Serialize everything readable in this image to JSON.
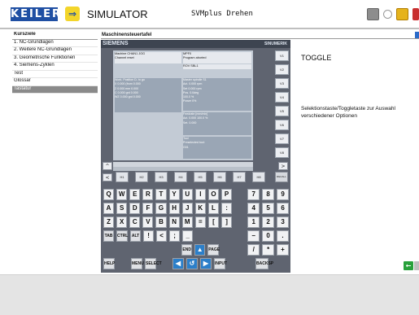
{
  "header": {
    "logo_text": "KEILER",
    "logo_arrow": "⇒",
    "title": "SIMULATOR",
    "subtitle": "SVMplus Drehen"
  },
  "nav": {
    "items": [
      {
        "label": "Kursziele",
        "active": false
      },
      {
        "label": "1. NC-Grundlagen",
        "active": false
      },
      {
        "label": "2. Weitere NC-Grundlagen",
        "active": false
      },
      {
        "label": "3. Geometrische Funktionen",
        "active": false
      },
      {
        "label": "4. Siemens-Zyklen",
        "active": false
      },
      {
        "label": "Test",
        "active": false
      },
      {
        "label": "Glossar",
        "active": false
      },
      {
        "label": "Tastatur",
        "active": true
      }
    ]
  },
  "content": {
    "title": "Maschinensteuertafel"
  },
  "panel": {
    "brand": "SIEMENS",
    "product": "SINUMERIK",
    "screen": {
      "top_left": [
        "Machine CHAN1   JOG",
        "Channel reset"
      ],
      "top_right": [
        "MPF0",
        "Program aborted",
        "ROV SBL1"
      ],
      "wcs_header": "Work.    Position    D- to go",
      "axes": [
        "X        0.000  (from    0.000",
        "Z        0.000  mm       0.000",
        "C        0.000  grd      0.000",
        "WZ       0.000  grd      0.000"
      ],
      "spindle_header": "Master spindle   S1",
      "spindle": [
        "Act.    0.000 rpm",
        "Set     0.000 rpm",
        "Pos.    0.0deg",
        "         100.0 %",
        "Power        0%"
      ],
      "feedrate_header": "Feedrate [mm/min]",
      "feedrate": [
        "Act.    0.000  100.0 %",
        "Set.    0.000"
      ],
      "tool_header": "Tool",
      "tool": [
        "Preselected tool:",
        "G01"
      ]
    },
    "vkeys": [
      "V1",
      "V2",
      "V3",
      "V4",
      "V5",
      "V6",
      "V7",
      "V8"
    ],
    "hkeys": [
      "H1",
      "H2",
      "H3",
      "H4",
      "H5",
      "H6",
      "H7",
      "H8"
    ],
    "recall": "RECALL",
    "rows": [
      {
        "left": "",
        "keys": [
          "Q",
          "W",
          "E",
          "R",
          "T",
          "Y",
          "U",
          "I",
          "O",
          "P"
        ],
        "right": [
          "7",
          "8",
          "9"
        ]
      },
      {
        "left": "",
        "keys": [
          "A",
          "S",
          "D",
          "F",
          "G",
          "H",
          "J",
          "K",
          "L",
          ":"
        ],
        "right": [
          "4",
          "5",
          "6"
        ]
      },
      {
        "left": "",
        "keys": [
          "Z",
          "X",
          "C",
          "V",
          "B",
          "N",
          "M",
          "=",
          "[",
          "]"
        ],
        "right": [
          "1",
          "2",
          "3"
        ]
      },
      {
        "left": "TAB",
        "keys": [
          "CTRL",
          "ALT",
          "!",
          "<",
          ";",
          "_"
        ],
        "right": [
          "–",
          "0",
          "."
        ]
      },
      {
        "left": "",
        "keys": [
          "END",
          "▲",
          "PAGE"
        ],
        "right": [
          "/",
          "*",
          "+"
        ]
      },
      {
        "left": "",
        "keys": [
          "HELP",
          "MENU",
          "SELECT",
          "◀",
          "↺",
          "▶",
          "INPUT"
        ],
        "right": [
          "BACKSP"
        ]
      },
      {
        "left": "",
        "keys": [
          "SHIFT",
          "NEXT",
          "PAGE",
          "CUSTOM",
          "END",
          "▼",
          "PAGE"
        ],
        "right": [
          "DEL",
          "?",
          "INSERT"
        ]
      }
    ]
  },
  "info": {
    "title": "TOGGLE",
    "text": "Selektionstaste/Toggletaste zur Auswahl verschiedener Optionen"
  },
  "footer": {
    "next_label": "←"
  }
}
